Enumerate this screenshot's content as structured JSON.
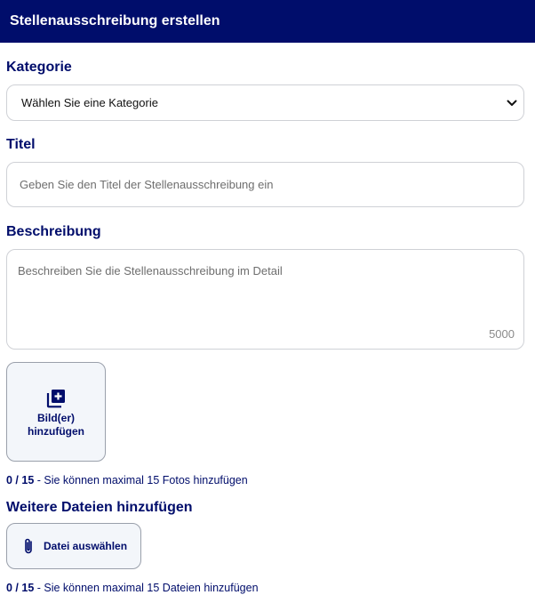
{
  "header": {
    "title": "Stellenausschreibung erstellen"
  },
  "category": {
    "label": "Kategorie",
    "selected": "Wählen Sie eine Kategorie",
    "icon": "chevron-down-icon"
  },
  "title_field": {
    "label": "Titel",
    "placeholder": "Geben Sie den Titel der Stellenausschreibung ein"
  },
  "description": {
    "label": "Beschreibung",
    "placeholder": "Beschreiben Sie die Stellenausschreibung im Detail",
    "char_limit": "5000"
  },
  "images": {
    "button_label": "Bild(er) hinzufügen",
    "icon": "add-photo-icon",
    "count": "0 / 15",
    "hint": " - Sie können maximal 15 Fotos hinzufügen"
  },
  "files": {
    "label": "Weitere Dateien hinzufügen",
    "button_label": "Datei auswählen",
    "icon": "paperclip-icon",
    "count": "0 / 15",
    "hint": " - Sie können maximal 15 Dateien hinzufügen"
  },
  "colors": {
    "header_bg": "#000d6b",
    "accent_text": "#000d6b",
    "border": "#cfd1d6"
  }
}
